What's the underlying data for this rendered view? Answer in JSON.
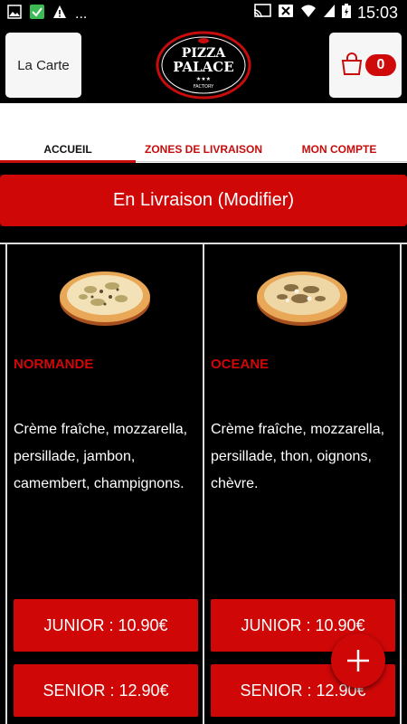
{
  "status_bar": {
    "time": "15:03",
    "overflow": "...",
    "battery_level": 0.8
  },
  "header": {
    "menu_button_label": "La Carte",
    "logo": {
      "line1": "PIZZA",
      "line2": "PALACE",
      "stars": "★★★",
      "tagline": "FACTORY"
    },
    "cart_count": "0"
  },
  "tabs": [
    {
      "label": "ACCUEIL",
      "active": true
    },
    {
      "label": "ZONES DE LIVRAISON",
      "active": false
    },
    {
      "label": "MON COMPTE",
      "active": false
    }
  ],
  "delivery_mode_label": "En Livraison (Modifier)",
  "products": [
    {
      "name": "NORMANDE",
      "description": "Crème fraîche, mozzarella, persillade, jambon, camembert, champignons.",
      "junior_label": "JUNIOR : 10.90€",
      "senior_label": "SENIOR : 12.90€"
    },
    {
      "name": "OCEANE",
      "description": "Crème fraîche, mozzarella, persillade, thon, oignons, chèvre.",
      "junior_label": "JUNIOR : 10.90€",
      "senior_label": "SENIOR : 12.90€"
    }
  ],
  "colors": {
    "accent_red": "#d00707",
    "background": "#000000",
    "button_light": "#f6f6f6"
  },
  "icons": [
    "image-icon",
    "check-box-icon",
    "warning-icon",
    "cast-icon",
    "wifi-x-icon",
    "wifi-icon",
    "signal-icon",
    "battery-icon",
    "shopping-bag-icon",
    "plus-icon"
  ]
}
